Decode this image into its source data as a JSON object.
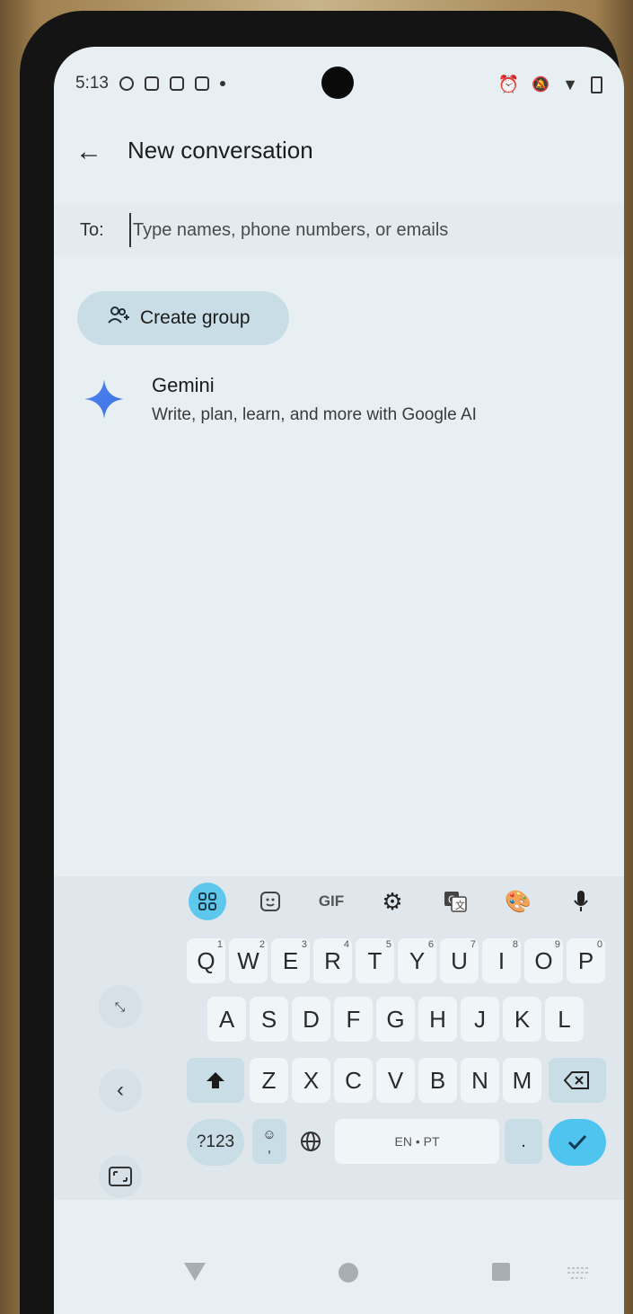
{
  "status_bar": {
    "time": "5:13"
  },
  "app_bar": {
    "title": "New conversation"
  },
  "recipient": {
    "label": "To:",
    "placeholder": "Type names, phone numbers, or emails"
  },
  "create_group": {
    "label": "Create group"
  },
  "gemini": {
    "name": "Gemini",
    "description": "Write, plan, learn, and more with Google AI"
  },
  "keyboard": {
    "toolbar": {
      "gif_label": "GIF"
    },
    "row1": [
      {
        "key": "Q",
        "hint": "1"
      },
      {
        "key": "W",
        "hint": "2"
      },
      {
        "key": "E",
        "hint": "3"
      },
      {
        "key": "R",
        "hint": "4"
      },
      {
        "key": "T",
        "hint": "5"
      },
      {
        "key": "Y",
        "hint": "6"
      },
      {
        "key": "U",
        "hint": "7"
      },
      {
        "key": "I",
        "hint": "8"
      },
      {
        "key": "O",
        "hint": "9"
      },
      {
        "key": "P",
        "hint": "0"
      }
    ],
    "row2": [
      "A",
      "S",
      "D",
      "F",
      "G",
      "H",
      "J",
      "K",
      "L"
    ],
    "row3": [
      "Z",
      "X",
      "C",
      "V",
      "B",
      "N",
      "M"
    ],
    "symbols_label": "?123",
    "emoji_key": "☺\n,",
    "space_label": "EN • PT",
    "period_label": "."
  },
  "colors": {
    "accent": "#5ec8ec",
    "chip_bg": "#c9dde6",
    "screen_bg": "#e8eff3"
  }
}
